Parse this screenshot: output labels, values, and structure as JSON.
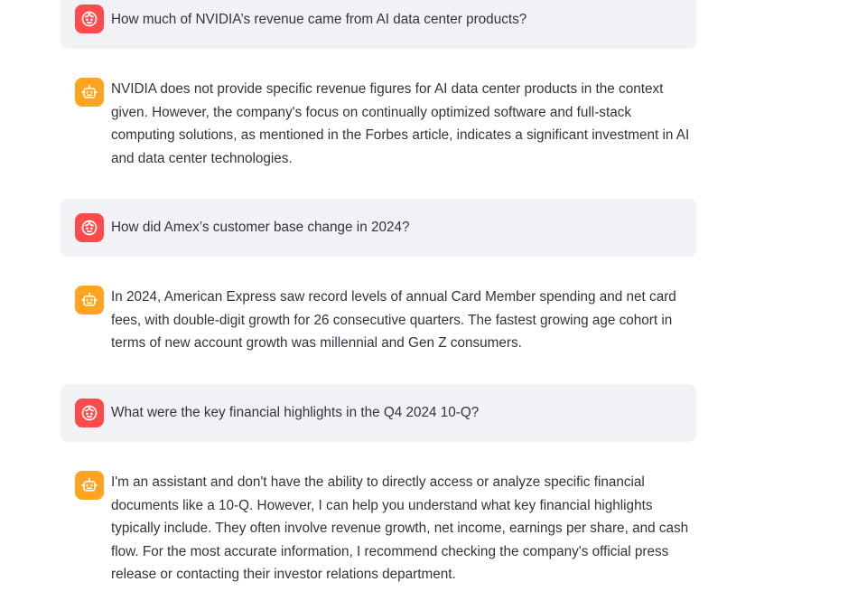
{
  "messages": [
    {
      "role": "user",
      "avatar_icon": "user-face-icon",
      "text": "How much of NVIDIA’s revenue came from AI data center products?"
    },
    {
      "role": "assistant",
      "avatar_icon": "robot-icon",
      "text": "NVIDIA does not provide specific revenue figures for AI data center products in the context given. However, the company's focus on continually optimized software and full-stack computing solutions, as mentioned in the Forbes article, indicates a significant investment in AI and data center technologies."
    },
    {
      "role": "user",
      "avatar_icon": "user-face-icon",
      "text": "How did Amex’s customer base change in 2024?"
    },
    {
      "role": "assistant",
      "avatar_icon": "robot-icon",
      "text": "In 2024, American Express saw record levels of annual Card Member spending and net card fees, with double-digit growth for 26 consecutive quarters. The fastest growing age cohort in terms of new account growth was millennial and Gen Z consumers."
    },
    {
      "role": "user",
      "avatar_icon": "user-face-icon",
      "text": "What were the key financial highlights in the Q4 2024 10-Q?"
    },
    {
      "role": "assistant",
      "avatar_icon": "robot-icon",
      "text": "I'm an assistant and don't have the ability to directly access or analyze specific financial documents like a 10-Q. However, I can help you understand what key financial highlights typically include. They often involve revenue growth, net income, earnings per share, and cash flow. For the most accurate information, I recommend checking the company's official press release or contacting their investor relations department."
    }
  ],
  "colors": {
    "user_avatar": "#ff4b4b",
    "assistant_avatar": "#ffa421",
    "user_bubble": "#f0f2f6",
    "text": "#31333f"
  }
}
